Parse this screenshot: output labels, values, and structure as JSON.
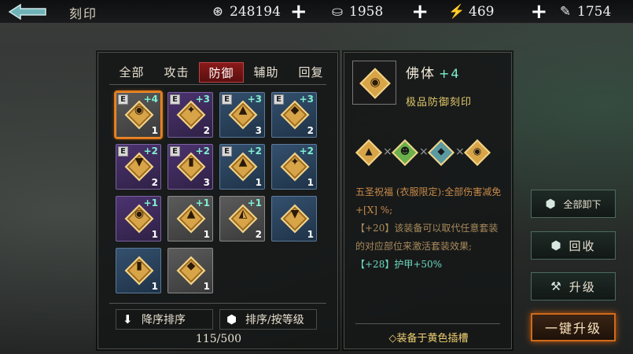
{
  "header": {
    "title": "刻印",
    "back_icon": "back-arrow-icon",
    "resources": [
      {
        "icon": "coin-icon",
        "glyph": "⊛",
        "value": "248194"
      },
      {
        "icon": "ingot-icon",
        "glyph": "⛀",
        "value": "1958"
      },
      {
        "icon": "stamina-icon",
        "glyph": "⚡",
        "value": "469"
      },
      {
        "icon": "scroll-icon",
        "glyph": "✎",
        "value": "1754"
      }
    ],
    "plus": "+"
  },
  "tabs": [
    "全部",
    "攻击",
    "防御",
    "辅助",
    "回复"
  ],
  "active_tab": 2,
  "grid": {
    "slots": [
      {
        "e": "E",
        "level": "+4",
        "count": "1",
        "quality": "gray",
        "selected": true,
        "glyph": "◉"
      },
      {
        "e": "E",
        "level": "+3",
        "count": "2",
        "quality": "purple",
        "selected": false,
        "glyph": "✦"
      },
      {
        "e": "E",
        "level": "+3",
        "count": "3",
        "quality": "blue",
        "selected": false,
        "glyph": "▲"
      },
      {
        "e": "E",
        "level": "+3",
        "count": "2",
        "quality": "blue",
        "selected": false,
        "glyph": "◆"
      },
      {
        "e": "E",
        "level": "+2",
        "count": "2",
        "quality": "purple",
        "selected": false,
        "glyph": "▼"
      },
      {
        "e": "E",
        "level": "+2",
        "count": "3",
        "quality": "purple",
        "selected": false,
        "glyph": "▮"
      },
      {
        "e": "E",
        "level": "+2",
        "count": "1",
        "quality": "blue",
        "selected": false,
        "glyph": "▲"
      },
      {
        "e": "",
        "level": "+2",
        "count": "1",
        "quality": "blue",
        "selected": false,
        "glyph": "✦"
      },
      {
        "e": "",
        "level": "+1",
        "count": "1",
        "quality": "purple",
        "selected": false,
        "glyph": "◉"
      },
      {
        "e": "",
        "level": "+1",
        "count": "1",
        "quality": "gray",
        "selected": false,
        "glyph": "▲"
      },
      {
        "e": "",
        "level": "+1",
        "count": "2",
        "quality": "gray",
        "selected": false,
        "glyph": "◭"
      },
      {
        "e": "",
        "level": "",
        "count": "1",
        "quality": "blue",
        "selected": false,
        "glyph": "▼"
      },
      {
        "e": "",
        "level": "",
        "count": "1",
        "quality": "blue",
        "selected": false,
        "glyph": "▮"
      },
      {
        "e": "",
        "level": "",
        "count": "1",
        "quality": "gray",
        "selected": false,
        "glyph": "◆"
      }
    ]
  },
  "sort": {
    "desc_icon": "down-arrow-icon",
    "desc_label": "降序排序",
    "by_icon": "cube-icon",
    "by_label": "排序/按等级"
  },
  "capacity": "115/500",
  "detail": {
    "name": "佛体",
    "plus": "+4",
    "subtitle": "极品防御刻印",
    "icon_glyph": "◉",
    "set_items": [
      {
        "glyph": "▲",
        "color": "#d8a448"
      },
      {
        "glyph": "☻",
        "color": "#6ab04c"
      },
      {
        "glyph": "◆",
        "color": "#5a9aa0"
      },
      {
        "glyph": "◉",
        "color": "#d8a448"
      }
    ],
    "effect_line1": "五圣祝福 (衣服限定):全部伤害减免+[X] %;",
    "effect_line2_tag": "【+20】",
    "effect_line2": "该装备可以取代任意套装的对应部位来激活套装效果;",
    "effect_line3_tag": "【+28】",
    "effect_line3": "护甲+50%",
    "equip_hint": "◇装备于黄色插槽"
  },
  "actions": [
    {
      "icon": "cube-icon",
      "glyph": "⬢",
      "label": "全部卸下"
    },
    {
      "icon": "cube-icon",
      "glyph": "⬢",
      "label": "回收"
    },
    {
      "icon": "hammer-icon",
      "glyph": "⚒",
      "label": "升级"
    },
    {
      "icon": "",
      "glyph": "",
      "label": "一键升级"
    }
  ]
}
